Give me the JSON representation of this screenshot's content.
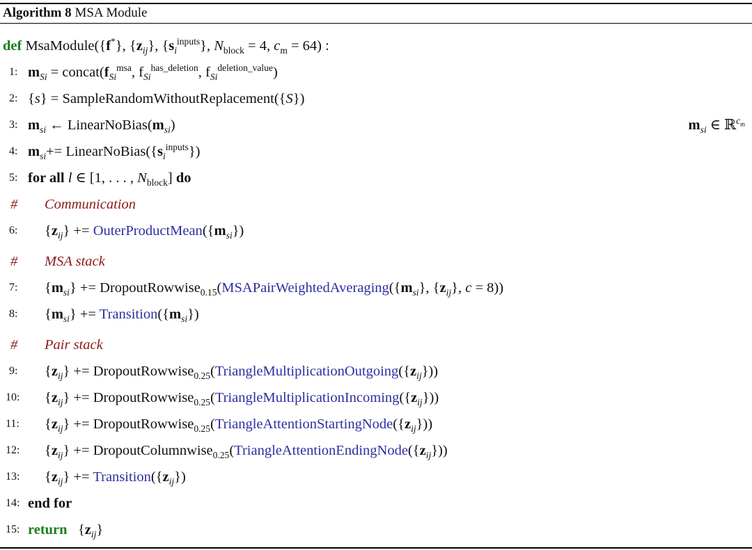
{
  "header": {
    "algo_label": "Algorithm 8",
    "algo_title": "MSA Module"
  },
  "signature": {
    "keyword": "def",
    "name": "MsaModule",
    "args": "({f*}, {zij}, {si^inputs}, Nblock = 4, cm = 64) :"
  },
  "lines": [
    {
      "num": "1:",
      "text": "mSi = concat(fSi^msa, fSi^has_deletion, fSi^deletion_value)"
    },
    {
      "num": "2:",
      "text": "{s} = SampleRandomWithoutReplacement({S})"
    },
    {
      "num": "3:",
      "text": "msi ← LinearNoBias(msi)",
      "side": "msi ∈ ℝ^cm"
    },
    {
      "num": "4:",
      "text": "msi += LinearNoBias({si^inputs})"
    },
    {
      "num": "5:",
      "text": "for all l ∈ [1, . . . , Nblock] do"
    },
    {
      "comment": "Communication"
    },
    {
      "num": "6:",
      "text": "{zij} += OuterProductMean({msi})"
    },
    {
      "comment": "MSA stack"
    },
    {
      "num": "7:",
      "text": "{msi} += DropoutRowwise0.15(MSAPairWeightedAveraging({msi}, {zij}, c = 8))"
    },
    {
      "num": "8:",
      "text": "{msi} += Transition({msi})"
    },
    {
      "comment": "Pair stack"
    },
    {
      "num": "9:",
      "text": "{zij} += DropoutRowwise0.25(TriangleMultiplicationOutgoing({zij}))"
    },
    {
      "num": "10:",
      "text": "{zij} += DropoutRowwise0.25(TriangleMultiplicationIncoming({zij}))"
    },
    {
      "num": "11:",
      "text": "{zij} += DropoutRowwise0.25(TriangleAttentionStartingNode({zij}))"
    },
    {
      "num": "12:",
      "text": "{zij} += DropoutColumnwise0.25(TriangleAttentionEndingNode({zij}))"
    },
    {
      "num": "13:",
      "text": "{zij} += Transition({zij})"
    },
    {
      "num": "14:",
      "text": "end for"
    },
    {
      "num": "15:",
      "text": "return {zij}"
    }
  ],
  "fn_names": {
    "concat": "concat",
    "sample": "SampleRandomWithoutReplacement",
    "linear": "LinearNoBias",
    "outer": "OuterProductMean",
    "dropout_row": "DropoutRowwise",
    "dropout_col": "DropoutColumnwise",
    "msa_pwa": "MSAPairWeightedAveraging",
    "transition": "Transition",
    "tri_out": "TriangleMultiplicationOutgoing",
    "tri_in": "TriangleMultiplicationIncoming",
    "tri_start": "TriangleAttentionStartingNode",
    "tri_end": "TriangleAttentionEndingNode"
  },
  "keywords": {
    "for_all": "for all",
    "do": "do",
    "end_for": "end for",
    "return": "return"
  },
  "comments": {
    "communication": "Communication",
    "msa_stack": "MSA stack",
    "pair_stack": "Pair stack"
  },
  "params": {
    "nblock": "4",
    "cm": "64",
    "dropout_msa": "0.15",
    "dropout_pair": "0.25",
    "c": "8"
  },
  "colors": {
    "keyword_green": "#1a7f1a",
    "function_blue": "#2e2ea0",
    "comment_red": "#8b1a1a"
  }
}
